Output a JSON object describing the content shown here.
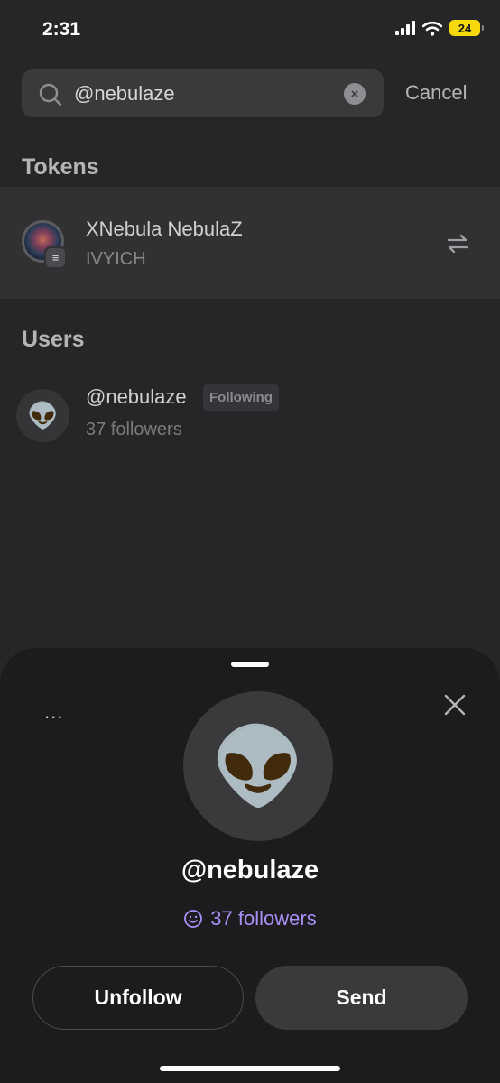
{
  "status_bar": {
    "time": "2:31",
    "battery": "24"
  },
  "search": {
    "value": "@nebulaze",
    "placeholder": "Search",
    "clear_glyph": "×",
    "cancel_label": "Cancel"
  },
  "tokens": {
    "title": "Tokens",
    "items": [
      {
        "name": "XNebula NebulaZ",
        "symbol": "IVYICH",
        "badge": "≡",
        "action_icon": "swap-arrows-icon"
      }
    ]
  },
  "users": {
    "title": "Users",
    "items": [
      {
        "handle": "@nebulaze",
        "badge": "Following",
        "followers": "37 followers",
        "avatar": "👽"
      }
    ]
  },
  "sheet": {
    "more": "...",
    "avatar": "👽",
    "handle": "@nebulaze",
    "followers": "37 followers",
    "unfollow_label": "Unfollow",
    "send_label": "Send",
    "accent": "#a98ff5"
  }
}
